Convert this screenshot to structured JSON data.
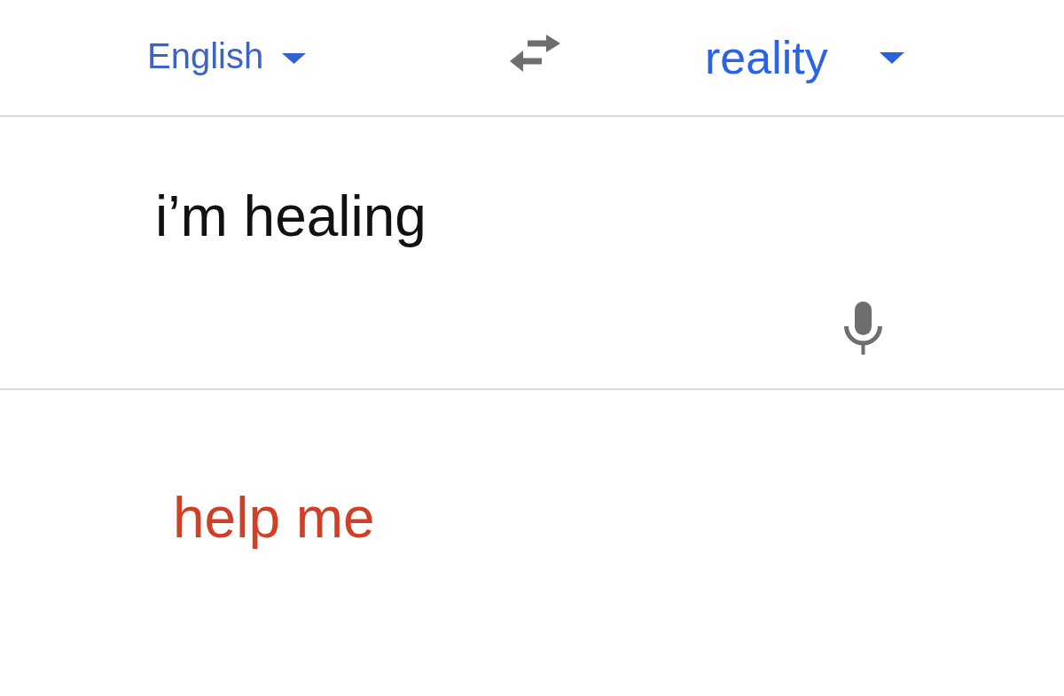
{
  "language_bar": {
    "source_language": "English",
    "target_language": "reality"
  },
  "input": {
    "value": "i’m healing"
  },
  "translation": {
    "text": "help me"
  }
}
